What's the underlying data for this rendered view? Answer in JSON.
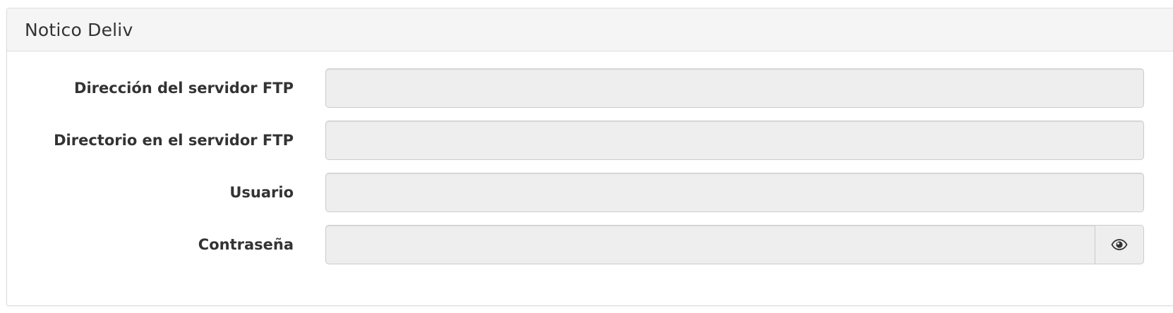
{
  "panel": {
    "title": "Notico Deliv"
  },
  "form": {
    "fields": [
      {
        "label": "Dirección del servidor FTP",
        "value": ""
      },
      {
        "label": "Directorio en el servidor FTP",
        "value": ""
      },
      {
        "label": "Usuario",
        "value": ""
      },
      {
        "label": "Contraseña",
        "value": ""
      }
    ],
    "password_toggle_icon": "eye-icon"
  }
}
